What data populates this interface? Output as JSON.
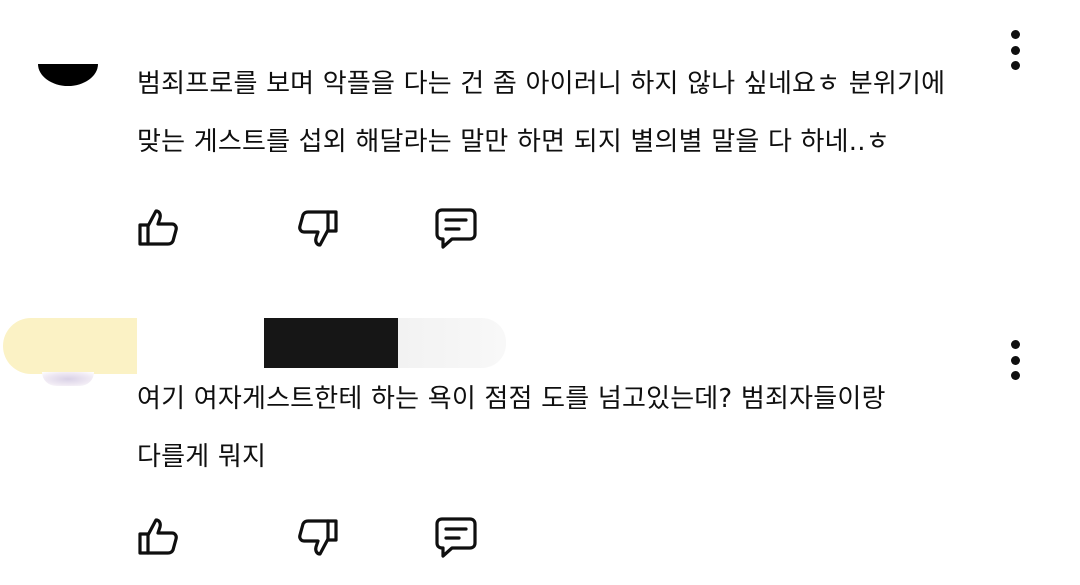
{
  "comments": [
    {
      "text_line1": "범죄프로를 보며 악플을 다는 건 좀 아이러니 하지 않나 싶네요ㅎ 분위기에",
      "text_line2": "맞는 게스트를 섭외 해달라는 말만 하면 되지 별의별 말을 다 하네..ㅎ",
      "icons": [
        "avatar",
        "more-vert-icon",
        "thumb-up-icon",
        "thumb-down-icon",
        "reply-icon"
      ]
    },
    {
      "text_line1": "여기 여자게스트한테 하는 욕이 점점 도를 넘고있는데? 범죄자들이랑",
      "text_line2": "다를게 뭐지",
      "icons": [
        "avatar",
        "more-vert-icon",
        "thumb-up-icon",
        "thumb-down-icon",
        "reply-icon"
      ]
    }
  ]
}
